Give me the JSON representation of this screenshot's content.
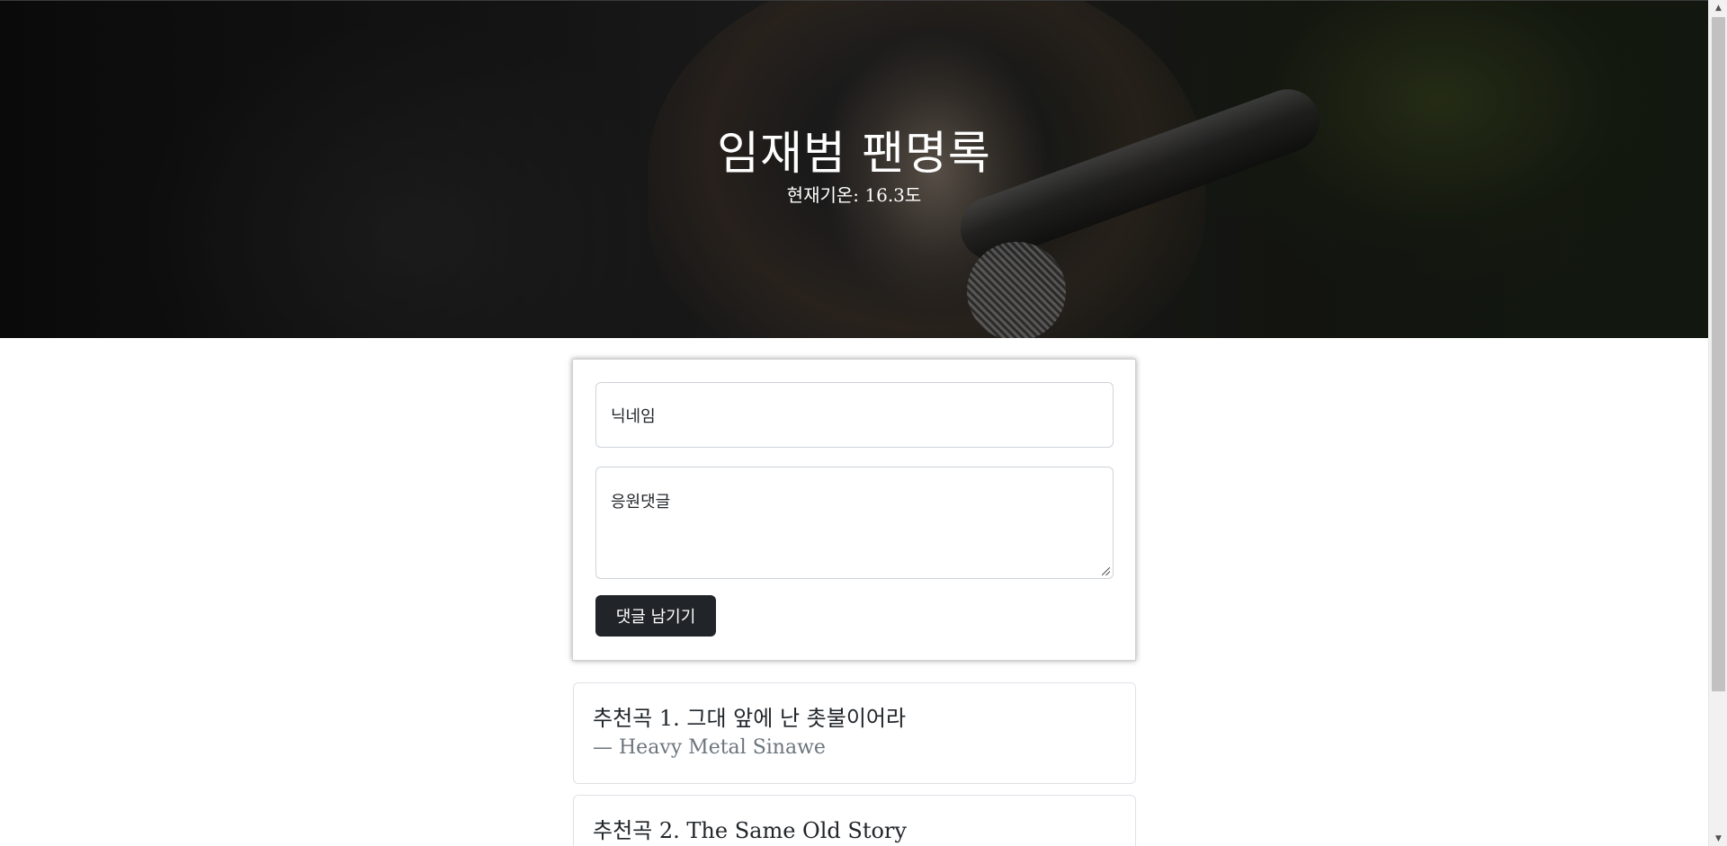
{
  "hero": {
    "title": "임재범 팬명록",
    "subtitle": "현재기온: 16.3도"
  },
  "form": {
    "nickname_placeholder": "닉네임",
    "comment_placeholder": "응원댓글",
    "submit_label": "댓글 남기기"
  },
  "songs": [
    {
      "title": "추천곡 1. 그대 앞에 난 촛불이어라",
      "artist": "— Heavy Metal Sinawe"
    },
    {
      "title": "추천곡 2. The Same Old Story",
      "artist": ""
    }
  ],
  "colors": {
    "button_bg": "#212529",
    "muted_text": "#6c757d",
    "border": "#dee2e6"
  }
}
